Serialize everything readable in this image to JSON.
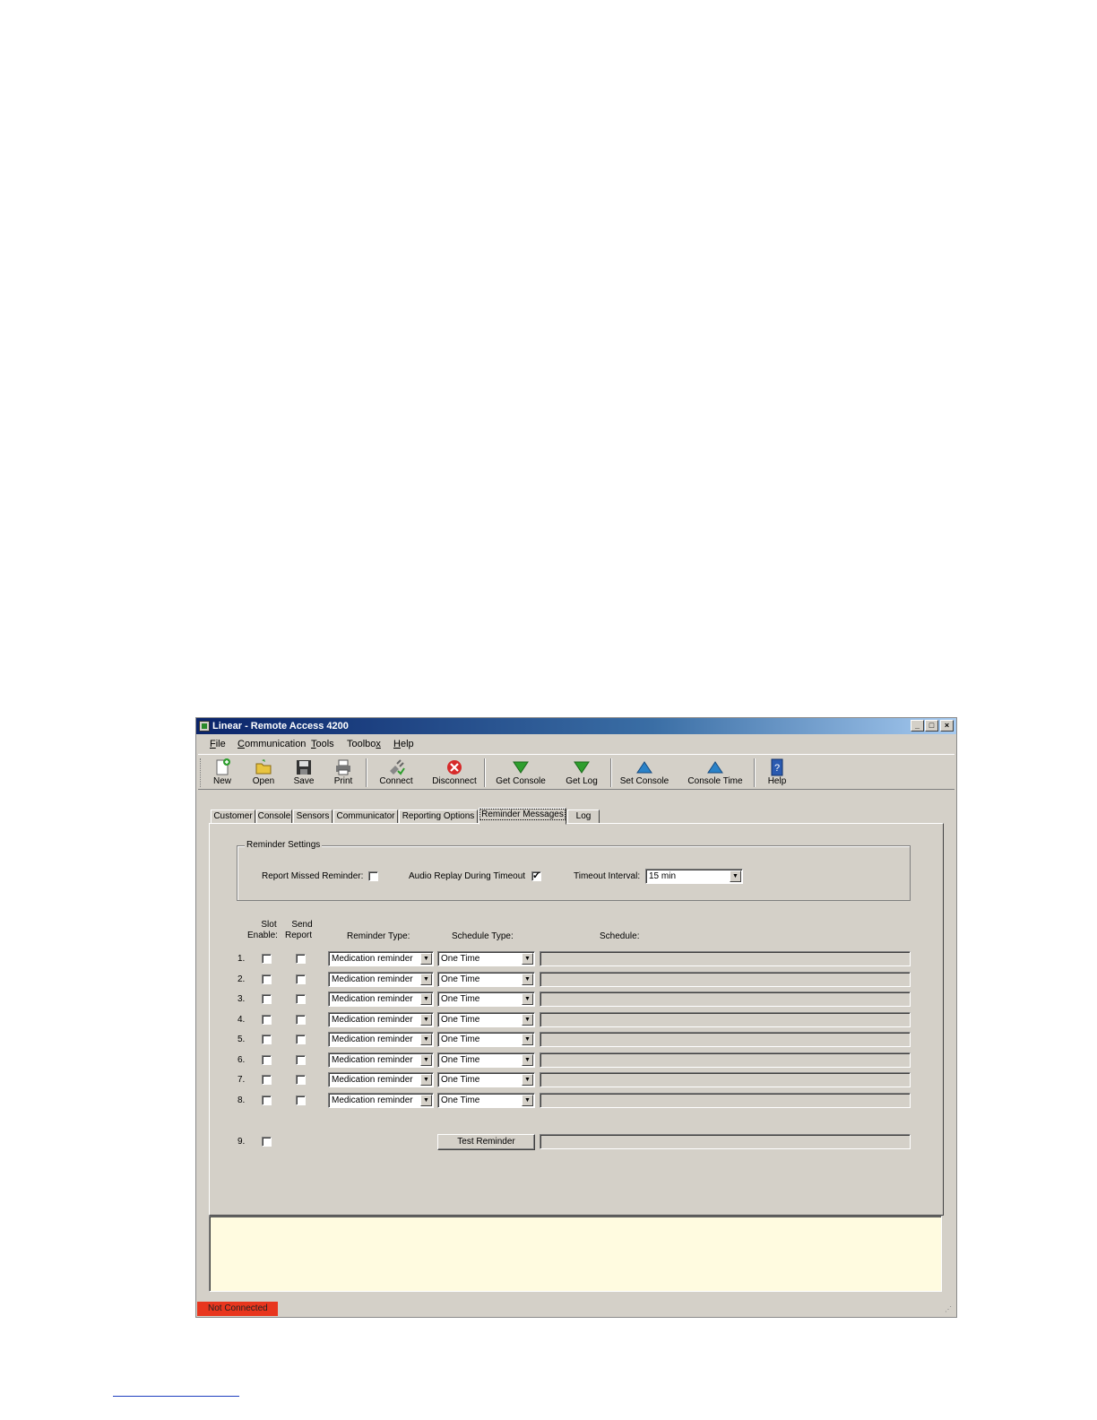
{
  "window": {
    "title": "Linear - Remote Access 4200"
  },
  "menu": [
    {
      "u": "F",
      "rest": "ile"
    },
    {
      "u": "C",
      "rest": "ommunication"
    },
    {
      "u": "T",
      "rest": "ools"
    },
    {
      "pre": "Toolbo",
      "u": "x",
      "rest": ""
    },
    {
      "u": "H",
      "rest": "elp"
    }
  ],
  "toolbar": {
    "new": "New",
    "open": "Open",
    "save": "Save",
    "print": "Print",
    "connect": "Connect",
    "disconnect": "Disconnect",
    "get_console": "Get Console",
    "get_log": "Get Log",
    "set_console": "Set Console",
    "console_time": "Console Time",
    "help": "Help"
  },
  "tabs": [
    "Customer",
    "Console",
    "Sensors",
    "Communicator",
    "Reporting Options",
    "Reminder Messages",
    "Log"
  ],
  "settings": {
    "group_title": "Reminder Settings",
    "report_missed_label": "Report Missed Reminder:",
    "report_missed_checked": false,
    "audio_replay_label": "Audio Replay During Timeout",
    "audio_replay_checked": true,
    "timeout_label": "Timeout Interval:",
    "timeout_value": "15 min"
  },
  "headers": {
    "slot_1": "Slot",
    "slot_2": "Enable:",
    "send_1": "Send",
    "send_2": "Report",
    "reminder_type": "Reminder Type:",
    "schedule_type": "Schedule Type:",
    "schedule": "Schedule:"
  },
  "rows": [
    {
      "num": "1.",
      "type": "Medication reminder",
      "schedule_type": "One Time"
    },
    {
      "num": "2.",
      "type": "Medication reminder",
      "schedule_type": "One Time"
    },
    {
      "num": "3.",
      "type": "Medication reminder",
      "schedule_type": "One Time"
    },
    {
      "num": "4.",
      "type": "Medication reminder",
      "schedule_type": "One Time"
    },
    {
      "num": "5.",
      "type": "Medication reminder",
      "schedule_type": "One Time"
    },
    {
      "num": "6.",
      "type": "Medication reminder",
      "schedule_type": "One Time"
    },
    {
      "num": "7.",
      "type": "Medication reminder",
      "schedule_type": "One Time"
    },
    {
      "num": "8.",
      "type": "Medication reminder",
      "schedule_type": "One Time"
    }
  ],
  "test_row": {
    "num": "9.",
    "button": "Test Reminder"
  },
  "status": {
    "connection": "Not Connected"
  },
  "colors": {
    "status_red": "#e8361e",
    "title_blue": "#0a246a",
    "message_bg": "#fffbe0"
  }
}
